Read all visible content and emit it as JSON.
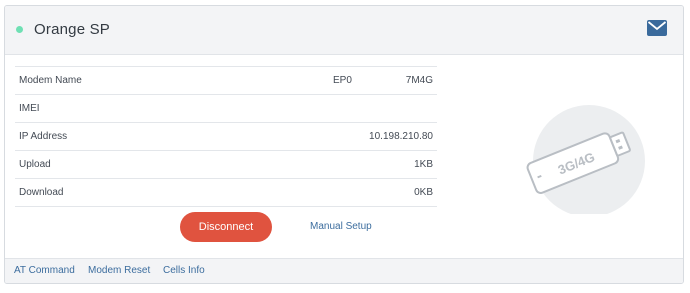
{
  "card": {
    "title": "Orange SP",
    "status_color": "#6fe0b4",
    "mail_icon": "envelope-icon"
  },
  "info": {
    "rows": [
      {
        "label": "Modem Name",
        "value_part1": "EP0",
        "value_part2": "7M4G"
      },
      {
        "label": "IMEI",
        "value": ""
      },
      {
        "label": "IP Address",
        "value": "10.198.210.80"
      },
      {
        "label": "Upload",
        "value": "1KB"
      },
      {
        "label": "Download",
        "value": "0KB"
      }
    ]
  },
  "actions": {
    "disconnect_label": "Disconnect",
    "manual_setup_label": "Manual Setup"
  },
  "illustration": {
    "modem_label": "3G/4G"
  },
  "footer": {
    "links": [
      "AT Command",
      "Modem Reset",
      "Cells Info"
    ]
  },
  "colors": {
    "accent_button": "#e0533f",
    "link": "#3c6d9e",
    "icon": "#3a6a9c"
  }
}
